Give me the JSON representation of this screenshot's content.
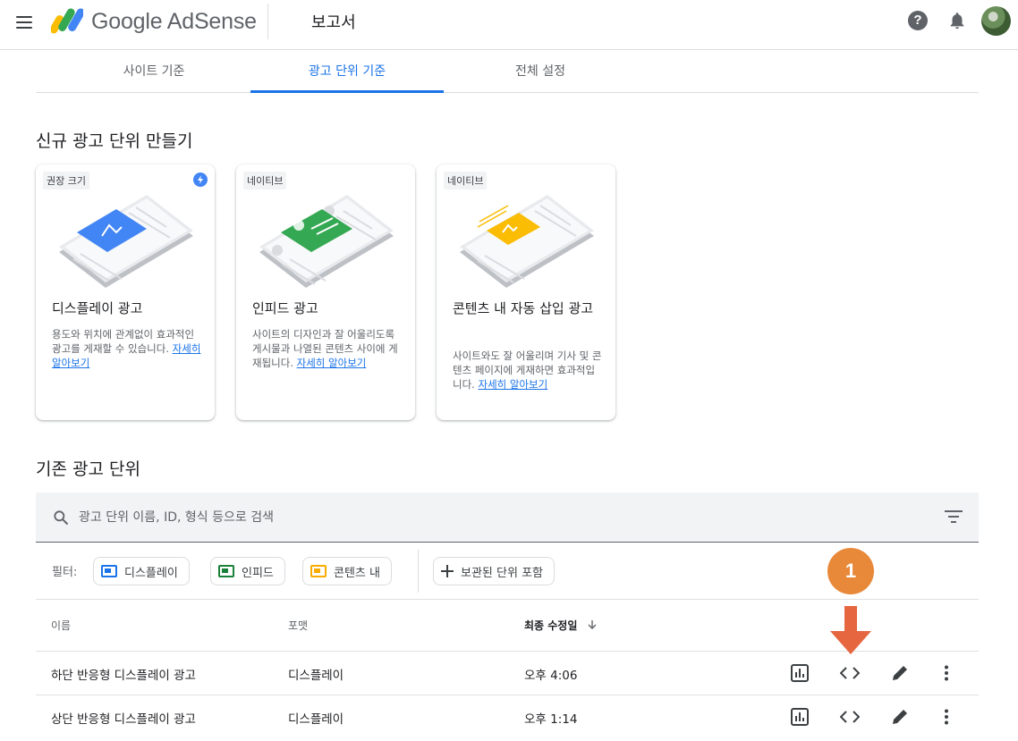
{
  "header": {
    "brand": "Google AdSense",
    "page_title": "보고서",
    "help_glyph": "?",
    "icons": [
      "menu-icon",
      "adsense-logo",
      "help-icon",
      "bell-icon",
      "avatar"
    ]
  },
  "tabs": [
    {
      "label": "사이트 기준",
      "active": false
    },
    {
      "label": "광고 단위 기준",
      "active": true
    },
    {
      "label": "전체 설정",
      "active": false
    }
  ],
  "create_section": {
    "title": "신규 광고 단위 만들기",
    "cards": [
      {
        "tag": "권장 크기",
        "title": "디스플레이 광고",
        "description": "용도와 위치에 관계없이 효과적인 광고를 게재할 수 있습니다.",
        "link": "자세히 알아보기",
        "accent": "#4285f4"
      },
      {
        "tag": "네이티브",
        "title": "인피드 광고",
        "description": "사이트의 디자인과 잘 어울리도록 게시물과 나열된 콘텐츠 사이에 게재됩니다.",
        "link": "자세히 알아보기",
        "accent": "#34a853"
      },
      {
        "tag": "네이티브",
        "title": "콘텐츠 내 자동 삽입 광고",
        "description": "사이트와도 잘 어울리며 기사 및 콘텐츠 페이지에 게재하면 효과적입니다.",
        "link": "자세히 알아보기",
        "accent": "#fbbc04"
      }
    ]
  },
  "existing_section": {
    "title": "기존 광고 단위",
    "search_placeholder": "광고 단위 이름, ID, 형식 등으로 검색",
    "filter_label": "필터:",
    "filter_chips": [
      {
        "label": "디스플레이",
        "color": "#1a73e8"
      },
      {
        "label": "인피드",
        "color": "#188038"
      },
      {
        "label": "콘텐츠 내",
        "color": "#f9ab00"
      }
    ],
    "archived_chip": "보관된 단위 포함",
    "columns": {
      "name": "이름",
      "format": "포맷",
      "modified": "최종 수정일",
      "sort_icon": "arrow-down-icon"
    },
    "rows": [
      {
        "name": "하단 반응형 디스플레이 광고",
        "format": "디스플레이",
        "modified": "오후 4:06"
      },
      {
        "name": "상단 반응형 디스플레이 광고",
        "format": "디스플레이",
        "modified": "오후 1:14"
      }
    ],
    "row_actions": [
      "report-icon",
      "code-icon",
      "edit-icon",
      "more-icon"
    ]
  },
  "annotation": {
    "badge": "1",
    "color": "#e8893a",
    "arrow_color": "#e5663f"
  }
}
